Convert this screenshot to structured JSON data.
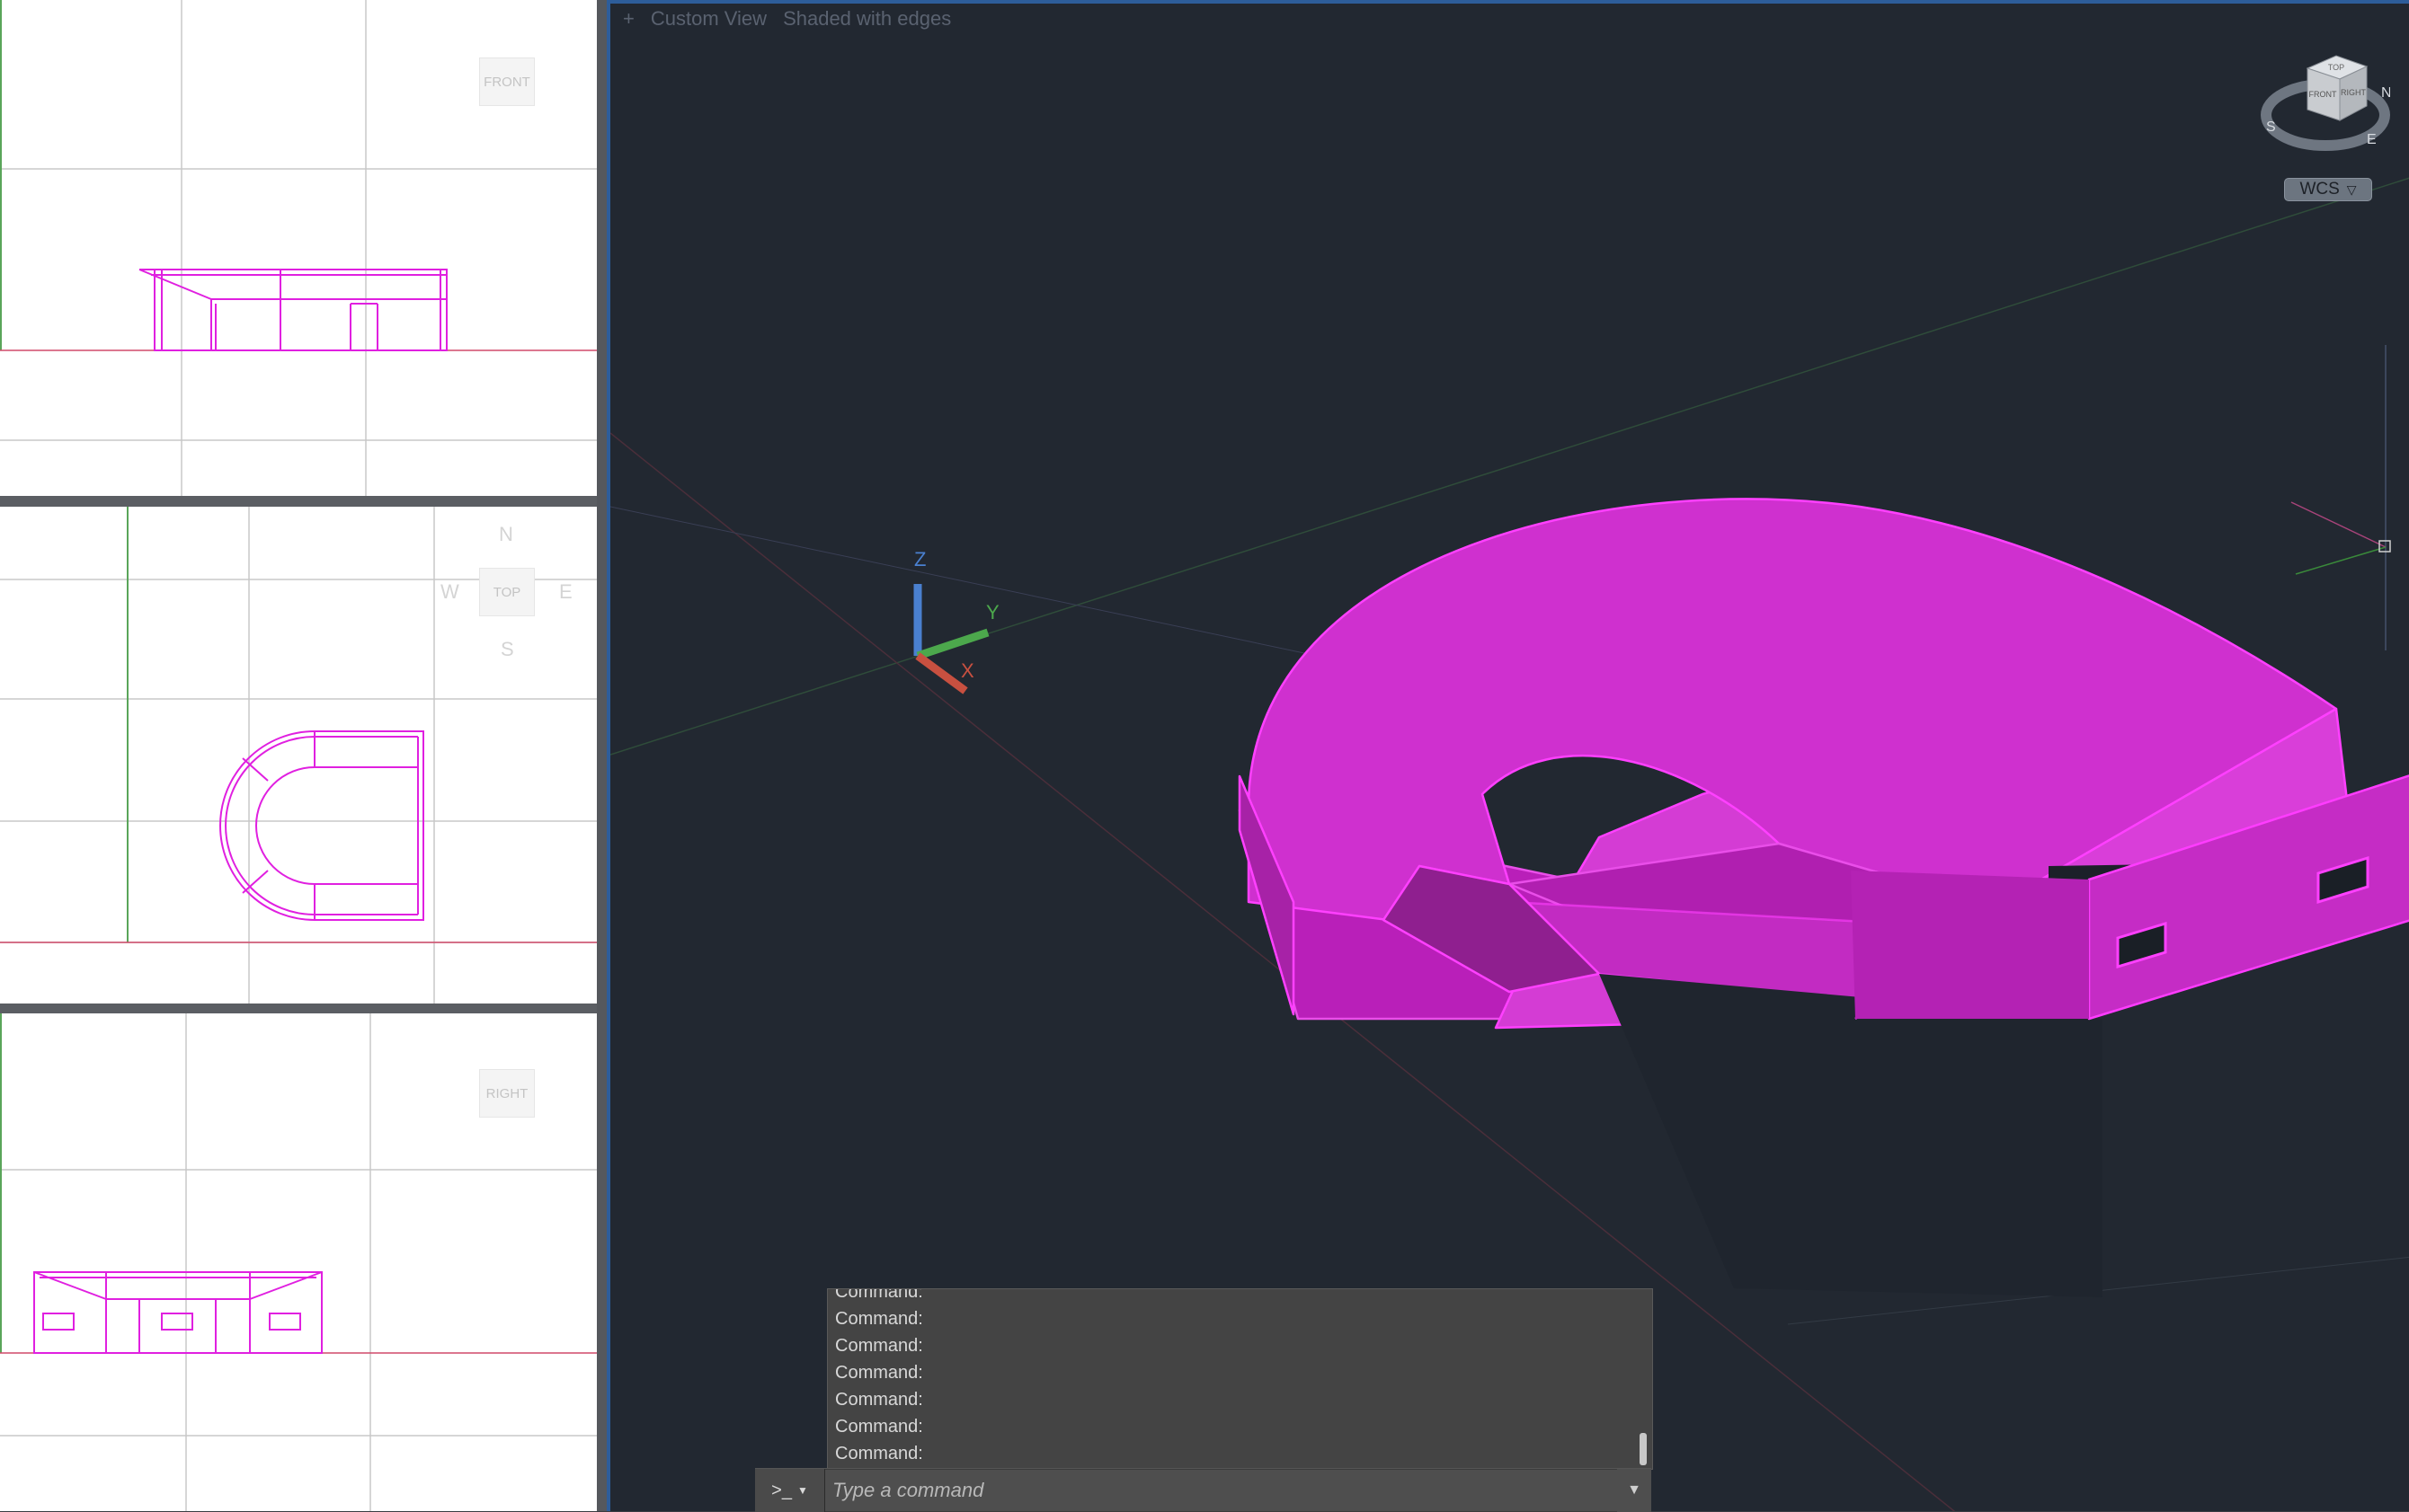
{
  "viewports": {
    "front": {
      "cube_label": "FRONT"
    },
    "top": {
      "cube_label": "TOP",
      "compass": {
        "n": "N",
        "w": "W",
        "e": "E",
        "s": "S"
      }
    },
    "right": {
      "cube_label": "RIGHT"
    },
    "main": {
      "controls": [
        "+",
        "Custom View",
        "Shaded with edges"
      ],
      "cube": {
        "face_top": "TOP",
        "face_front": "FRONT",
        "face_right": "RIGHT",
        "compass": {
          "n": "N",
          "e": "E",
          "s": "S"
        }
      },
      "ucs": "WCS",
      "axes": {
        "x": "X",
        "y": "Y",
        "z": "Z"
      }
    }
  },
  "command_history": [
    "Command:",
    "Command:",
    "Command:",
    "Command:",
    "Command:",
    "Command:",
    "Command:"
  ],
  "command_prompt_symbol": ">_",
  "command_placeholder": "Type a command",
  "colors": {
    "model": "#e81ee8",
    "model_face": "#c826c8",
    "background": "#222831",
    "accent_border": "#2d5d9a"
  }
}
